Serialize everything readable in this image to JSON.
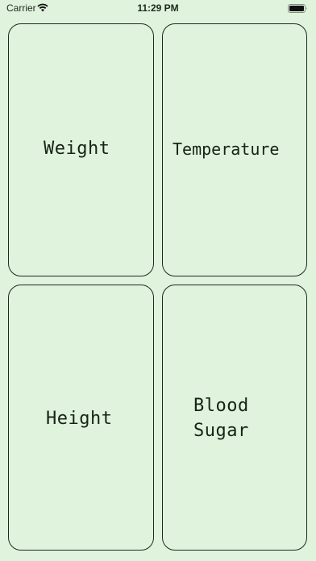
{
  "status_bar": {
    "carrier": "Carrier",
    "time": "11:29 PM",
    "wifi_icon": "wifi-icon",
    "battery_icon": "battery-icon"
  },
  "cards": {
    "weight": {
      "label": "Weight"
    },
    "temperature": {
      "label": "Temperature"
    },
    "height": {
      "label": "Height"
    },
    "blood_sugar": {
      "label_line1": "Blood",
      "label_line2": "Sugar"
    }
  },
  "colors": {
    "background": "#e0f3dc",
    "border": "#1d2b1d",
    "text": "#162416"
  }
}
